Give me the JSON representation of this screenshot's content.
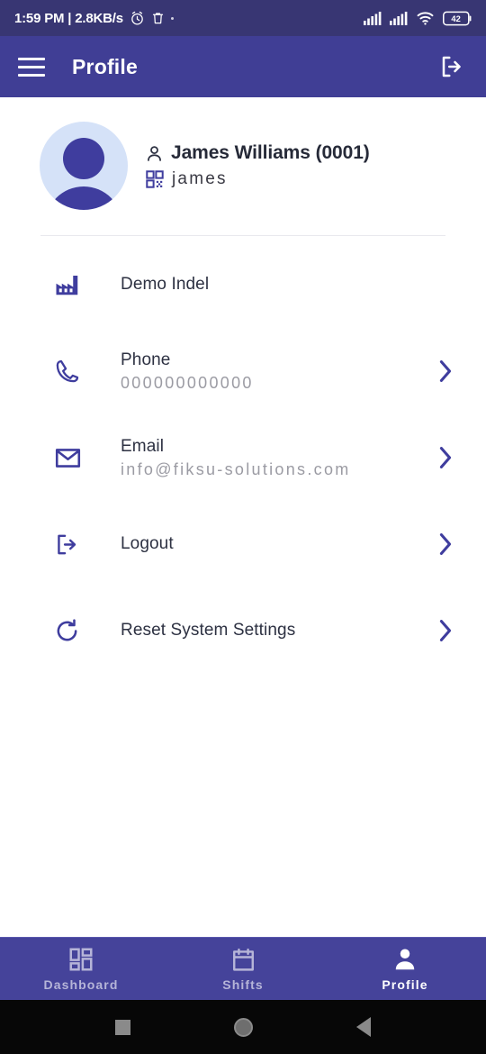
{
  "statusbar": {
    "text": "1:59 PM | 2.8KB/s",
    "icons": [
      "alarm-icon",
      "trash-icon",
      "dot-icon"
    ],
    "right_icons": [
      "signal-icon",
      "signal-icon",
      "wifi-icon",
      "battery-icon"
    ],
    "battery_level": "42"
  },
  "appbar": {
    "menu_icon": "hamburger-menu-icon",
    "title": "Profile",
    "action_icon": "logout-icon",
    "color": "#403e95"
  },
  "profile": {
    "avatar_icon": "user-avatar-icon",
    "name_icon": "person-icon",
    "name": "James Williams (0001)",
    "username_icon": "qr-code-icon",
    "username": "james"
  },
  "list": {
    "items": [
      {
        "icon": "factory-icon",
        "label": "Demo Indel",
        "value": "",
        "chevron": false
      },
      {
        "icon": "phone-icon",
        "label": "Phone",
        "value": "000000000000",
        "chevron": true
      },
      {
        "icon": "email-icon",
        "label": "Email",
        "value": "info@fiksu-solutions.com",
        "chevron": true
      },
      {
        "icon": "logout-icon",
        "label": "Logout",
        "value": "",
        "chevron": true
      },
      {
        "icon": "refresh-icon",
        "label": "Reset System Settings",
        "value": "",
        "chevron": true
      }
    ]
  },
  "bottomnav": {
    "tabs": [
      {
        "icon": "dashboard-icon",
        "label": "Dashboard",
        "active": false
      },
      {
        "icon": "calendar-icon",
        "label": "Shifts",
        "active": false
      },
      {
        "icon": "person-icon",
        "label": "Profile",
        "active": true
      }
    ],
    "color": "#45439a"
  },
  "androidnav": {
    "buttons": [
      "recents-square-icon",
      "home-circle-icon",
      "back-triangle-icon"
    ]
  },
  "colors": {
    "primary": "#403e95",
    "statusbar": "#383673",
    "accent": "#3f3d9e",
    "label": "#2d3142",
    "value": "#9b9ba3"
  }
}
